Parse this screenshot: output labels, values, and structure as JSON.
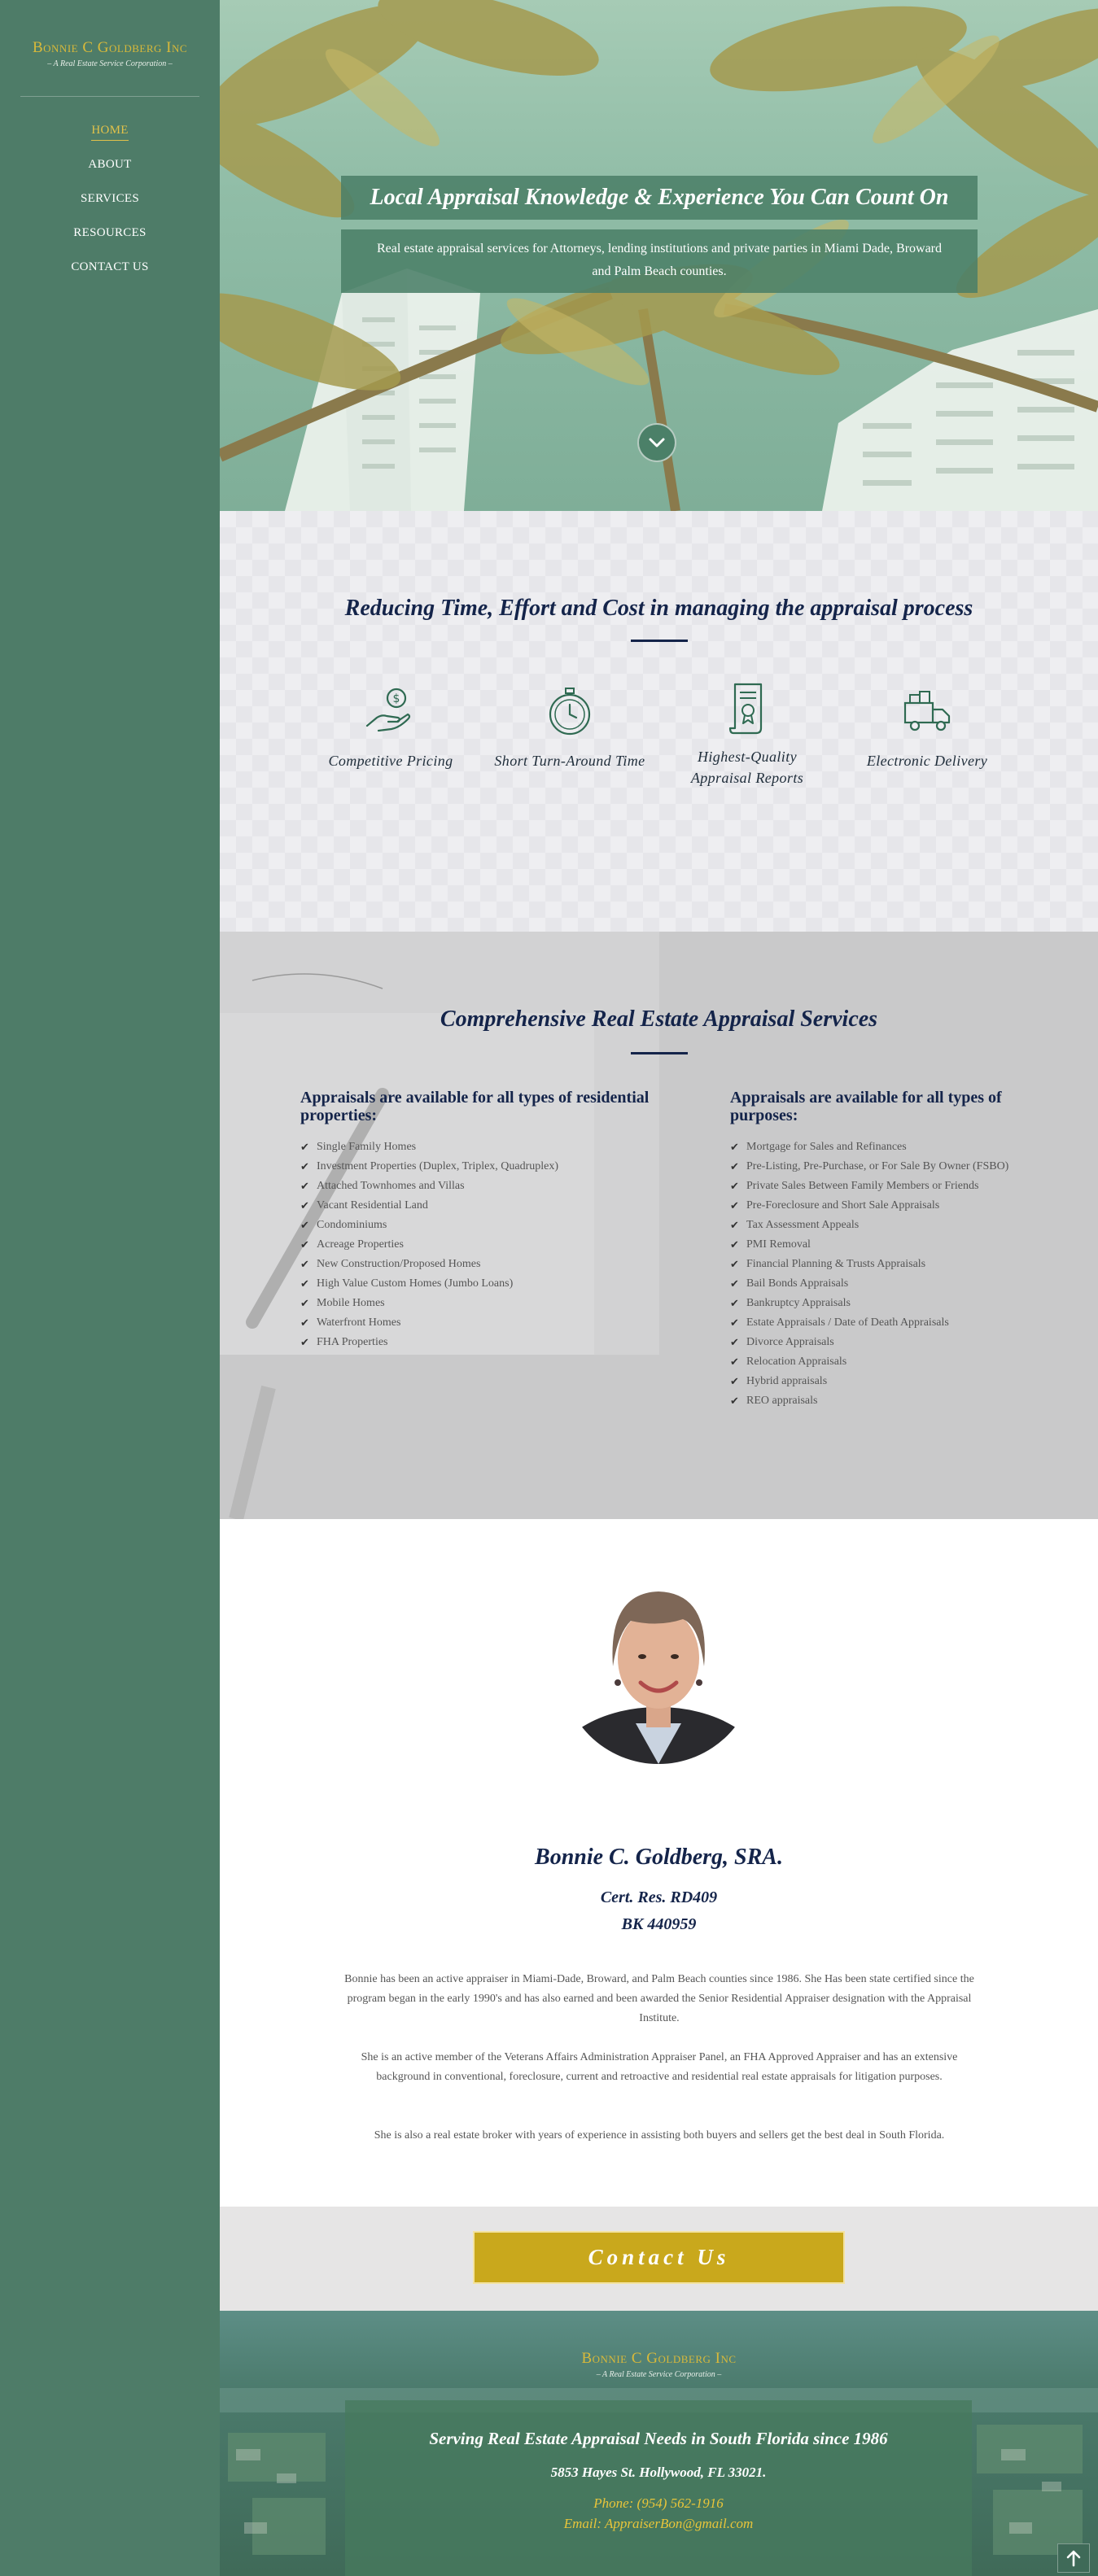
{
  "brand": {
    "name": "Bonnie C Goldberg Inc",
    "tagline": "– A Real Estate Service Corporation –"
  },
  "nav": {
    "items": [
      {
        "label": "HOME",
        "active": true
      },
      {
        "label": "ABOUT",
        "active": false
      },
      {
        "label": "SERVICES",
        "active": false
      },
      {
        "label": "RESOURCES",
        "active": false
      },
      {
        "label": "CONTACT US",
        "active": false
      }
    ]
  },
  "hero": {
    "title": "Local Appraisal Knowledge & Experience You Can Count On",
    "subtitle": "Real estate appraisal services for Attorneys, lending institutions and private parties in Miami Dade, Broward and Palm Beach counties.",
    "scroll_icon": "chevron-down-icon"
  },
  "features": {
    "title": "Reducing Time, Effort and Cost in managing the appraisal process",
    "items": [
      {
        "label": "Competitive Pricing",
        "icon": "hand-dollar-icon"
      },
      {
        "label": "Short Turn-Around Time",
        "icon": "stopwatch-icon"
      },
      {
        "label": "Highest-Quality Appraisal Reports",
        "icon": "certificate-scroll-icon"
      },
      {
        "label": "Electronic Delivery",
        "icon": "delivery-truck-icon"
      }
    ]
  },
  "services": {
    "title": "Comprehensive Real Estate Appraisal Services",
    "residential": {
      "heading": "Appraisals are available for all types of residential properties:",
      "items": [
        "Single Family Homes",
        "Investment Properties (Duplex, Triplex, Quadruplex)",
        "Attached Townhomes and Villas",
        "Vacant Residential Land",
        "Condominiums",
        "Acreage Properties",
        "New Construction/Proposed Homes",
        "High Value Custom Homes (Jumbo Loans)",
        "Mobile Homes",
        "Waterfront Homes",
        "FHA Properties"
      ]
    },
    "purposes": {
      "heading": "Appraisals are available for all types of purposes:",
      "items": [
        "Mortgage for Sales and Refinances",
        "Pre-Listing, Pre-Purchase, or For Sale By Owner (FSBO)",
        "Private Sales Between Family Members or Friends",
        "Pre-Foreclosure and Short Sale Appraisals",
        "Tax Assessment Appeals",
        "PMI Removal",
        "Financial Planning & Trusts Appraisals",
        "Bail Bonds Appraisals",
        "Bankruptcy Appraisals",
        "Estate Appraisals / Date of Death Appraisals",
        "Divorce Appraisals",
        "Relocation Appraisals",
        "Hybrid appraisals",
        "REO appraisals"
      ]
    }
  },
  "bio": {
    "name": "Bonnie C. Goldberg, SRA.",
    "cert1": "Cert. Res. RD409",
    "cert2": "BK 440959",
    "p1": "Bonnie has been an active appraiser in Miami-Dade, Broward, and Palm Beach counties since 1986. She Has been state certified since the program began in the early 1990's and has also earned and been awarded the Senior Residential Appraiser designation with the Appraisal Institute.",
    "p2": "She is an active member of the Veterans Affairs Administration Appraiser Panel, an FHA Approved Appraiser and has an extensive background in conventional, foreclosure, current and retroactive and residential real estate appraisals for litigation purposes.",
    "p3": "She is also a real estate broker with years of experience in assisting both buyers and sellers get the best deal in South Florida."
  },
  "contact": {
    "button": "Contact Us"
  },
  "footer": {
    "tagline": "Serving Real Estate Appraisal Needs in South Florida since 1986",
    "address": "5853 Hayes St. Hollywood, FL 33021.",
    "phone": "Phone: (954) 562-1916",
    "email": "Email: AppraiserBon@gmail.com"
  },
  "colors": {
    "sidebar": "#4e7c68",
    "accent_gold": "#c9a81c",
    "navy": "#14244a"
  }
}
